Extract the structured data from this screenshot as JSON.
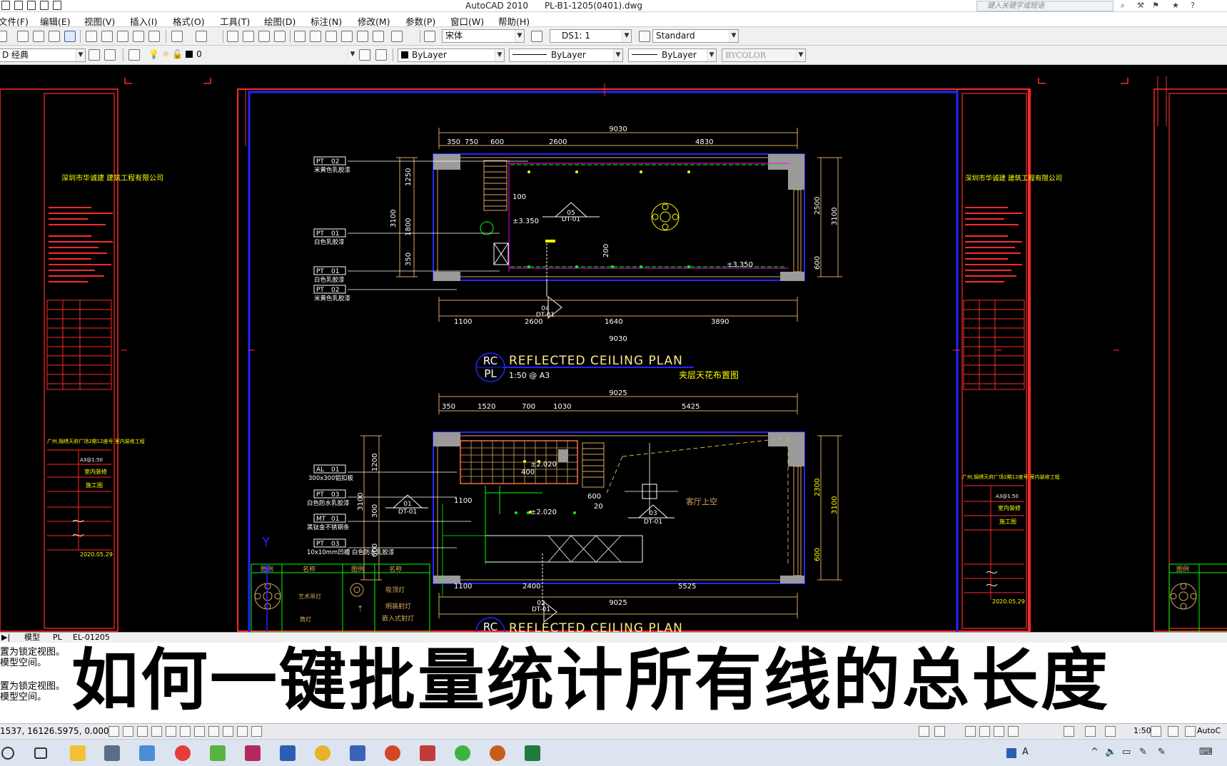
{
  "window": {
    "app": "AutoCAD 2010",
    "file": "PL-B1-1205(0401).dwg",
    "help_placeholder": "键入关键字或短语"
  },
  "menu": [
    "文件(F)",
    "编辑(E)",
    "视图(V)",
    "插入(I)",
    "格式(O)",
    "工具(T)",
    "绘图(D)",
    "标注(N)",
    "修改(M)",
    "参数(P)",
    "窗口(W)",
    "帮助(H)"
  ],
  "toolbar": {
    "font": "宋体",
    "dim_style": "DS1: 1",
    "table_style": "Standard",
    "workspace": "D 经典",
    "layer": "0",
    "color": "ByLayer",
    "linetype": "ByLayer",
    "lineweight": "ByLayer",
    "plot_style": "BYCOLOR"
  },
  "drawing": {
    "plan1": {
      "marker_top": "RC",
      "marker_bottom": "PL",
      "title": "REFLECTED  CEILING  PLAN",
      "scale": "1:50 @ A3",
      "title_cn": "夹层天花布置图",
      "dims_top_total": "9030",
      "dims_top": [
        "350",
        "750",
        "600",
        "2600",
        "4830"
      ],
      "dims_bottom": [
        "1100",
        "2600",
        "1640",
        "3890"
      ],
      "dims_bottom_total": "9030",
      "dims_left": [
        "1250",
        "1800",
        "350"
      ],
      "dims_left_total": "3100",
      "dims_right": [
        "2500",
        "600"
      ],
      "dims_right_total": "3100",
      "tags": [
        {
          "code": "PT",
          "num": "02",
          "desc": "米黄色乳胶漆"
        },
        {
          "code": "PT",
          "num": "01",
          "desc": "白色乳胶漆"
        },
        {
          "code": "PT",
          "num": "01",
          "desc": "白色乳胶漆"
        },
        {
          "code": "PT",
          "num": "02",
          "desc": "米黄色乳胶漆"
        }
      ],
      "section_a": {
        "num": "05",
        "ref": "DT-01"
      },
      "section_b": {
        "num": "04",
        "ref": "DT-01"
      },
      "level_1": "±3.350",
      "level_2": "±3.350",
      "dim_100": "100",
      "dim_200": "200"
    },
    "plan2": {
      "marker_top": "RC",
      "title": "REFLECTED  CEILING  PLAN",
      "dims_top_total": "9025",
      "dims_top": [
        "350",
        "1520",
        "700",
        "1030",
        "5425"
      ],
      "dims_bottom": [
        "1100",
        "2400",
        "5525"
      ],
      "dims_bottom_total": "9025",
      "dims_left": [
        "1200",
        "300",
        "600"
      ],
      "dims_left_total": "3100",
      "dims_right": [
        "2300",
        "600"
      ],
      "dims_right_total": "3100",
      "tags": [
        {
          "code": "AL",
          "num": "01",
          "desc": "300x300铝扣板"
        },
        {
          "code": "PT",
          "num": "03",
          "desc": "白色防水乳胶漆"
        },
        {
          "code": "MT",
          "num": "01",
          "desc": "黑钛金不锈钢条"
        },
        {
          "code": "PT",
          "num": "03",
          "desc": "10x10mm凹槽 白色防水乳胶漆"
        }
      ],
      "void_label": "客厅上空",
      "section_a": {
        "num": "01",
        "ref": "DT-01"
      },
      "section_b": {
        "num": "03",
        "ref": "DT-01"
      },
      "section_c": {
        "num": "02",
        "ref": "DT-01"
      },
      "level_1": "±2.020",
      "level_2": "±2.020",
      "dim_400": "400",
      "dim_1100": "1100",
      "dim_600": "600",
      "dim_20": "20"
    },
    "legend": {
      "headers": [
        "图例",
        "名称",
        "图例",
        "名称"
      ],
      "rows": [
        "艺术吊灯",
        "吸顶灯",
        "明装射灯",
        "嵌入式射灯",
        "筒灯"
      ]
    },
    "titleblock": {
      "company": "深圳市华诚建 建筑工程有限公司",
      "project": "广州,锦绣天府广场2期12座号 室内装修工程",
      "scale": "A3@1:50",
      "level": "室内装修",
      "stage": "施工图",
      "date": "2020.05.29"
    },
    "ucs": "Y"
  },
  "layout_tabs": [
    "模型",
    "PL",
    "EL-01205"
  ],
  "command_lines": [
    "置为锁定视图。",
    "模型空间。",
    "置为锁定视图。",
    "模型空间。"
  ],
  "caption": "如何一键批量统计所有线的总长度",
  "status": {
    "coords": "1537, 16126.5975, 0.0000",
    "scale": "1:50",
    "autocad": "AutoC"
  },
  "taskbar_ime": "A",
  "colors": {
    "ui_bg": "#f0f0f0",
    "drawing_bg": "#000000",
    "frame": "#ff2a2a",
    "plan": "#d9a95f",
    "blue": "#2424ff",
    "yellow": "#ffff00",
    "green": "#00ff00",
    "magenta": "#ff00ff"
  }
}
